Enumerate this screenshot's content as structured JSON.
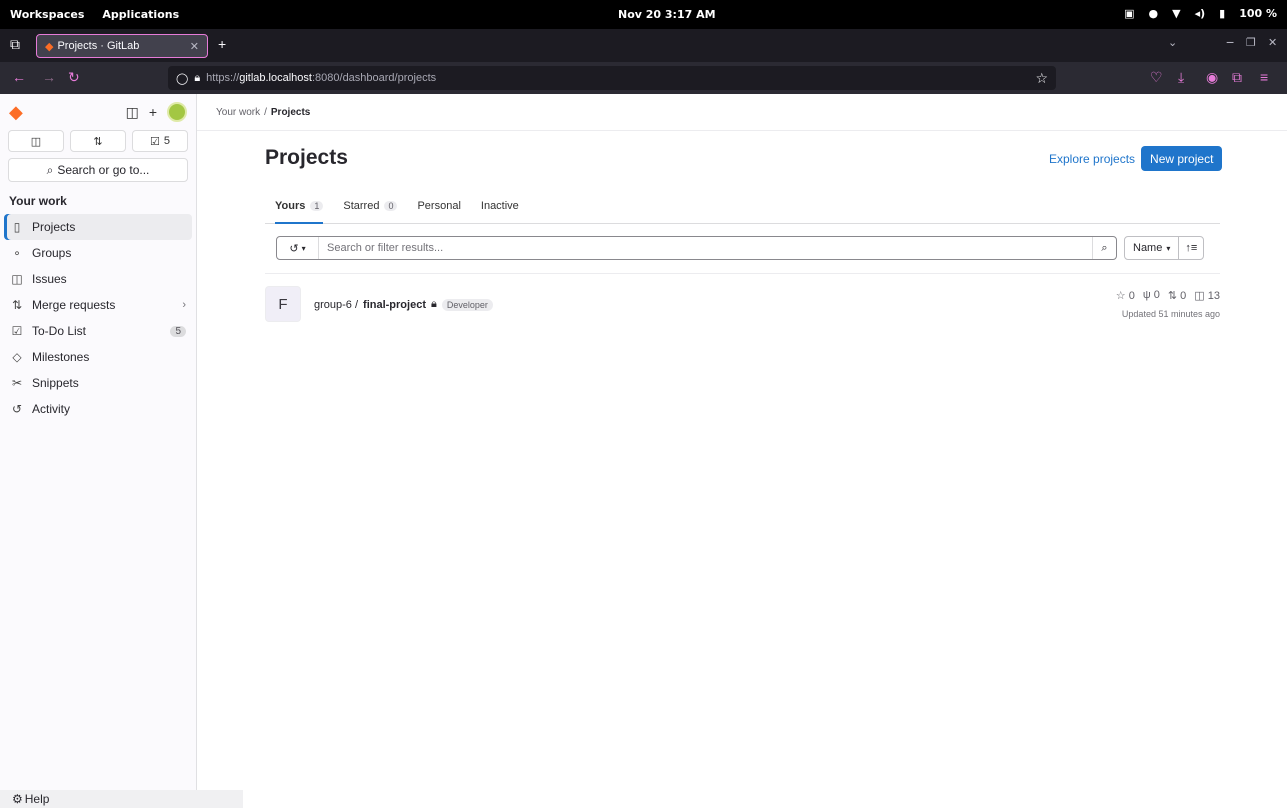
{
  "os": {
    "workspaces": "Workspaces",
    "applications": "Applications",
    "clock": "Nov 20  3:17 AM",
    "battery": "100 %"
  },
  "browser": {
    "tab_title": "Projects · GitLab",
    "url_prefix": "https://",
    "url_host": "gitlab.localhost",
    "url_rest": ":8080/dashboard/projects"
  },
  "sidebar": {
    "todo_count": "5",
    "search_label": "Search or go to...",
    "section_title": "Your work",
    "items": [
      {
        "label": "Projects",
        "icon": "project-icon"
      },
      {
        "label": "Groups",
        "icon": "group-icon"
      },
      {
        "label": "Issues",
        "icon": "issues-icon"
      },
      {
        "label": "Merge requests",
        "icon": "merge-request-icon"
      },
      {
        "label": "To-Do List",
        "icon": "todo-icon",
        "count": "5"
      },
      {
        "label": "Milestones",
        "icon": "milestone-icon"
      },
      {
        "label": "Snippets",
        "icon": "snippet-icon"
      },
      {
        "label": "Activity",
        "icon": "activity-icon"
      }
    ],
    "help_label": "Help"
  },
  "breadcrumb": {
    "parent": "Your work",
    "separator": "/",
    "current": "Projects"
  },
  "page": {
    "title": "Projects",
    "explore_label": "Explore projects",
    "new_project_label": "New project"
  },
  "tabs": [
    {
      "label": "Yours",
      "count": "1"
    },
    {
      "label": "Starred",
      "count": "0"
    },
    {
      "label": "Personal"
    },
    {
      "label": "Inactive"
    }
  ],
  "filter": {
    "placeholder": "Search or filter results...",
    "sort_label": "Name"
  },
  "project": {
    "avatar_letter": "F",
    "namespace": "group-6 /",
    "name": "final-project",
    "role": "Developer",
    "stars": "0",
    "forks": "0",
    "merge_requests": "0",
    "issues": "13",
    "updated": "Updated 51 minutes ago"
  }
}
